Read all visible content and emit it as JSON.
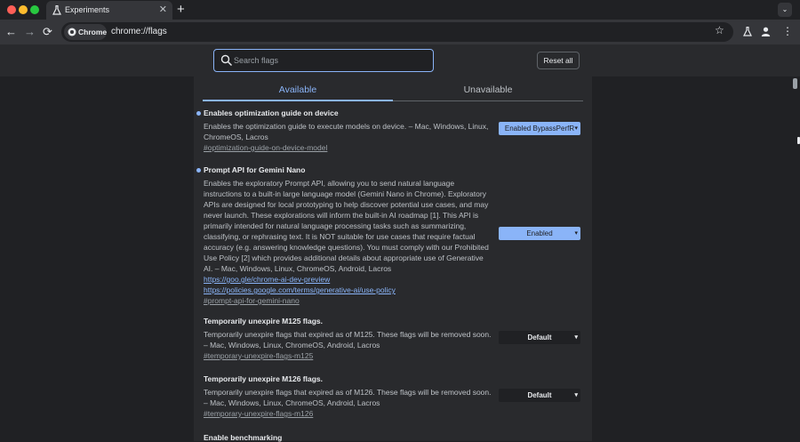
{
  "tabbar": {
    "tab_title": "Experiments",
    "close_glyph": "✕",
    "newtab_glyph": "+",
    "menu_glyph": "⌄",
    "colors": {
      "close": "#ff5f57",
      "minimize": "#febc2e",
      "zoom": "#28c840"
    }
  },
  "toolbar": {
    "back_glyph": "←",
    "forward_glyph": "→",
    "reload_glyph": "⟳",
    "chip_label": "Chrome",
    "url": "chrome://flags",
    "star_glyph": "☆",
    "more_glyph": "⋮"
  },
  "header": {
    "search_placeholder": "Search flags",
    "reset_label": "Reset all"
  },
  "tabs": {
    "available": "Available",
    "unavailable": "Unavailable"
  },
  "flags": [
    {
      "title": "Enables optimization guide on device",
      "description": "Enables the optimization guide to execute models on device. – Mac, Windows, Linux, ChromeOS, Lacros",
      "links": [],
      "anchor": "#optimization-guide-on-device-model",
      "value": "Enabled BypassPerfR",
      "modified": true
    },
    {
      "title": "Prompt API for Gemini Nano",
      "description": "Enables the exploratory Prompt API, allowing you to send natural language instructions to a built-in large language model (Gemini Nano in Chrome). Exploratory APIs are designed for local prototyping to help discover potential use cases, and may never launch. These explorations will inform the built-in AI roadmap [1]. This API is primarily intended for natural language processing tasks such as summarizing, classifying, or rephrasing text. It is NOT suitable for use cases that require factual accuracy (e.g. answering knowledge questions). You must comply with our Prohibited Use Policy [2] which provides additional details about appropriate use of Generative AI. – Mac, Windows, Linux, ChromeOS, Android, Lacros",
      "links": [
        "https://goo.gle/chrome-ai-dev-preview",
        "https://policies.google.com/terms/generative-ai/use-policy"
      ],
      "anchor": "#prompt-api-for-gemini-nano",
      "value": "Enabled",
      "modified": true
    },
    {
      "title": "Temporarily unexpire M125 flags.",
      "description": "Temporarily unexpire flags that expired as of M125. These flags will be removed soon. – Mac, Windows, Linux, ChromeOS, Android, Lacros",
      "links": [],
      "anchor": "#temporary-unexpire-flags-m125",
      "value": "Default",
      "modified": false
    },
    {
      "title": "Temporarily unexpire M126 flags.",
      "description": "Temporarily unexpire flags that expired as of M126. These flags will be removed soon. – Mac, Windows, Linux, ChromeOS, Android, Lacros",
      "links": [],
      "anchor": "#temporary-unexpire-flags-m126",
      "value": "Default",
      "modified": false
    },
    {
      "title": "Enable benchmarking",
      "description": "",
      "links": [],
      "anchor": "",
      "value": "",
      "modified": false
    }
  ]
}
